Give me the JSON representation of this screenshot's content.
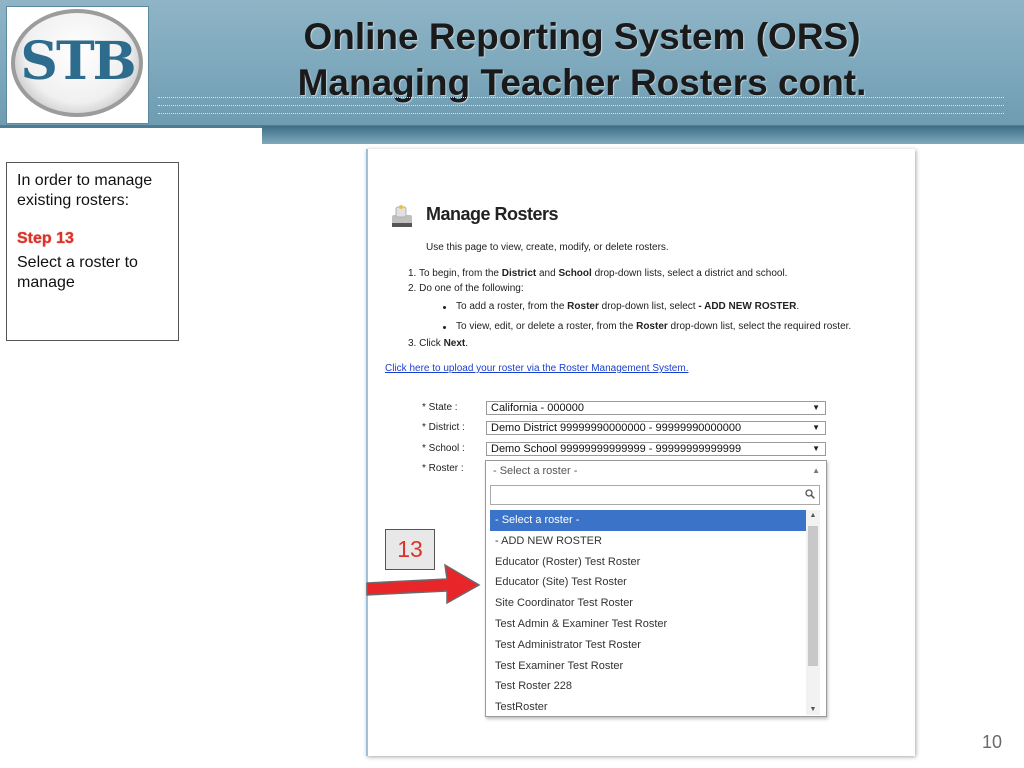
{
  "header": {
    "logo_text": "STB",
    "title_line1": "Online Reporting System (ORS)",
    "title_line2": "Managing Teacher Rosters  cont."
  },
  "instructions": {
    "intro": "In order to manage existing rosters:",
    "step_label": "Step 13",
    "step_text": "Select a roster to manage"
  },
  "screenshot": {
    "title": "Manage Rosters",
    "subtitle": "Use this page to view, create, modify, or delete rosters.",
    "step1": {
      "a": "1. To begin, from the ",
      "b": "District",
      "c": " and ",
      "d": "School",
      "e": " drop-down lists, select a district and school."
    },
    "step2": "2. Do one of the following:",
    "bullet1": {
      "a": "To add a roster, from the ",
      "b": "Roster",
      "c": " drop-down list, select ",
      "d": "- ADD NEW ROSTER",
      "e": "."
    },
    "bullet2": {
      "a": "To view, edit, or delete a roster, from the ",
      "b": "Roster",
      "c": " drop-down list, select the required roster."
    },
    "step3": {
      "a": "3. Click ",
      "b": "Next",
      "c": "."
    },
    "upload_link": "Click here to upload your roster via the Roster Management System.",
    "fields": {
      "state_label": "* State :",
      "state_value": "California - 000000",
      "district_label": "* District :",
      "district_value": "Demo District 99999990000000 - 99999990000000",
      "school_label": "* School :",
      "school_value": "Demo School 99999999999999 - 99999999999999",
      "roster_label": "* Roster :",
      "roster_value": "- Select a roster -"
    },
    "dropdown_items": [
      "- Select a roster -",
      "- ADD NEW ROSTER",
      "Educator (Roster) Test Roster",
      "Educator (Site) Test Roster",
      "Site Coordinator Test Roster",
      "Test Admin & Examiner Test Roster",
      "Test Administrator Test Roster",
      "Test Examiner Test Roster",
      "Test Roster 228",
      "TestRoster"
    ]
  },
  "callout": "13",
  "page_number": "10",
  "colors": {
    "header": "#7fa9bd",
    "accent_red": "#d9342a",
    "selected_blue": "#3a73c8",
    "link_blue": "#1a3fcf"
  }
}
